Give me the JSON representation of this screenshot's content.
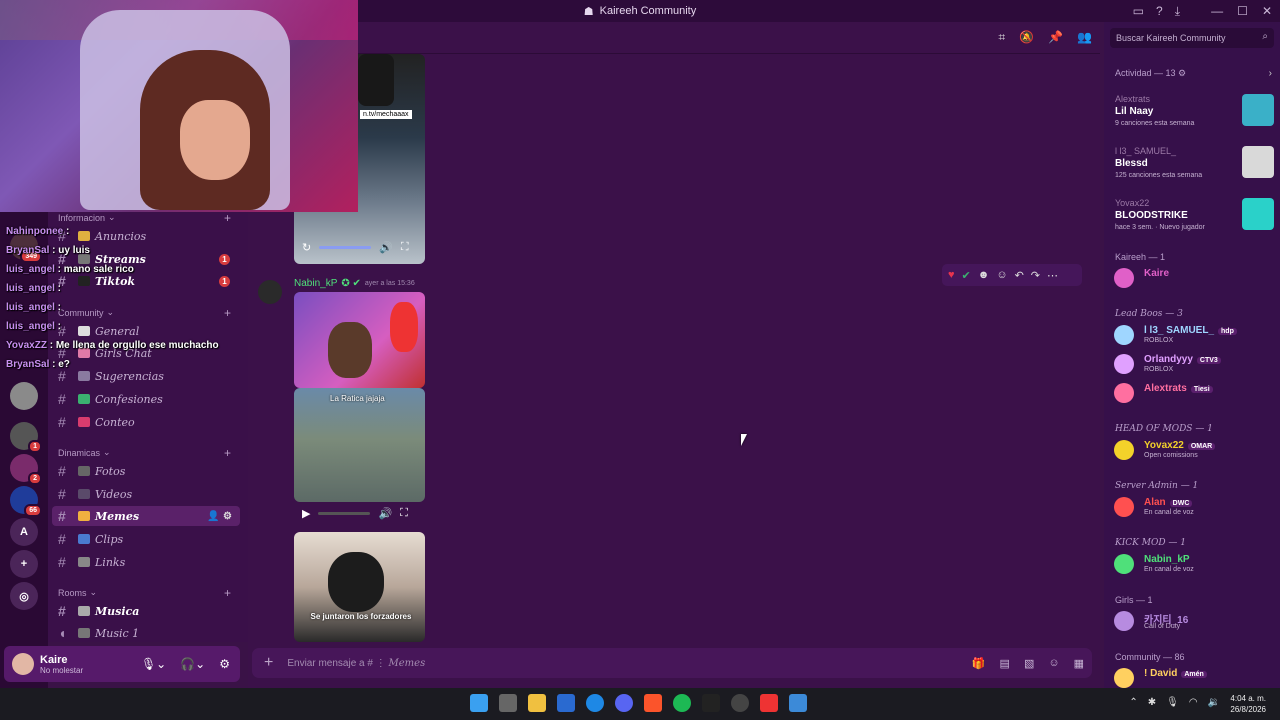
{
  "window": {
    "title": "Kaireeh Community"
  },
  "sidebar": {
    "categories": {
      "info": "Informacion",
      "community": "Community",
      "dynamics": "Dinamicas",
      "rooms": "Rooms"
    },
    "channels": {
      "anuncios": "Anuncios",
      "streams": "Streams",
      "tiktok": "Tiktok",
      "general": "General",
      "girls_chat": "Girls Chat",
      "sugerencias": "Sugerencias",
      "confesiones": "Confesiones",
      "conteo": "Conteo",
      "fotos": "Fotos",
      "videos": "Videos",
      "memes": "Memes",
      "clips": "Clips",
      "links": "Links",
      "musica": "Musica",
      "music1": "Music 1"
    },
    "mentions": {
      "streams": "1",
      "tiktok": "1"
    }
  },
  "rail": {
    "badges": [
      "349",
      "1",
      "2",
      "66"
    ],
    "letter": "A"
  },
  "user_panel": {
    "name": "Kaire",
    "status": "No molestar"
  },
  "chat": {
    "videos_stream_url": "n.tv/mechaaax",
    "message": {
      "author": "Nabin_kP",
      "timestamp": "ayer a las 15:36"
    },
    "video_caption_1": "La Ratica jajaja",
    "video_caption_2": "Se juntaron los forzadores"
  },
  "composer": {
    "placeholder_prefix": "Enviar mensaje a #",
    "placeholder_channel": "Memes"
  },
  "search": {
    "placeholder": "Buscar Kaireeh Community"
  },
  "activity": {
    "header": "Actividad — 13",
    "items": [
      {
        "user": "Alextrats",
        "title": "Lil Naay",
        "sub": "9 canciones esta semana",
        "art": "#3ab0c8"
      },
      {
        "user": "l l3_ SAMUEL_",
        "title": "Blessd",
        "sub": "125 canciones esta semana",
        "art": "#d9d9d9"
      },
      {
        "user": "Yovax22",
        "title": "BLOODSTRIKE",
        "sub": "hace 3 sem. · Nuevo jugador",
        "art": "#2ad1c9"
      }
    ]
  },
  "members": {
    "groups": [
      {
        "title": "Kaireeh — 1",
        "plain": true,
        "members": [
          {
            "name": "Kaire",
            "color": "#e060c8",
            "tag": "",
            "sub": ""
          }
        ]
      },
      {
        "title": "Lead Boos — 3",
        "plain": false,
        "members": [
          {
            "name": "l l3_ SAMUEL_",
            "color": "#9fd6ff",
            "tag": "hdp",
            "sub": "ROBLOX"
          },
          {
            "name": "Orlandyyy",
            "color": "#e0a0ff",
            "tag": "CTV3",
            "sub": "ROBLOX"
          },
          {
            "name": "Alextrats",
            "color": "#ff6fa0",
            "tag": "Tiesi",
            "sub": ""
          }
        ]
      },
      {
        "title": "HEAD OF MODS — 1",
        "plain": false,
        "members": [
          {
            "name": "Yovax22",
            "color": "#f3d22a",
            "tag": "OMAR",
            "sub": "Open comissions"
          }
        ]
      },
      {
        "title": "Server Admin — 1",
        "plain": false,
        "members": [
          {
            "name": "Alan",
            "color": "#ff5050",
            "tag": "DWC",
            "sub": "En canal de voz"
          }
        ]
      },
      {
        "title": "KICK MOD — 1",
        "plain": false,
        "members": [
          {
            "name": "Nabin_kP",
            "color": "#4fe07a",
            "tag": "",
            "sub": "En canal de voz"
          }
        ]
      },
      {
        "title": "Girls — 1",
        "plain": true,
        "members": [
          {
            "name": "카지티_16",
            "color": "#b78be0",
            "tag": "",
            "sub": "Call of Duty"
          }
        ]
      },
      {
        "title": "Community — 86",
        "plain": true,
        "members": [
          {
            "name": "! David",
            "color": "#ffd060",
            "tag": "Amén",
            "sub": ""
          }
        ]
      }
    ]
  },
  "stream_chat": [
    {
      "user": "Nahinponee",
      "text": ""
    },
    {
      "user": "BryanSal",
      "text": "uy luis"
    },
    {
      "user": "luis_angel",
      "text": "mano sale rico"
    },
    {
      "user": "luis_angel",
      "text": ""
    },
    {
      "user": "luis_angel",
      "text": ""
    },
    {
      "user": "luis_angel",
      "text": ""
    },
    {
      "user": "YovaxZZ",
      "text": "Me llena de orgullo ese muchacho"
    },
    {
      "user": "BryanSal",
      "text": "e?"
    }
  ],
  "taskbar": {
    "time": "4:04 a. m.",
    "date": "26/8/2026"
  }
}
